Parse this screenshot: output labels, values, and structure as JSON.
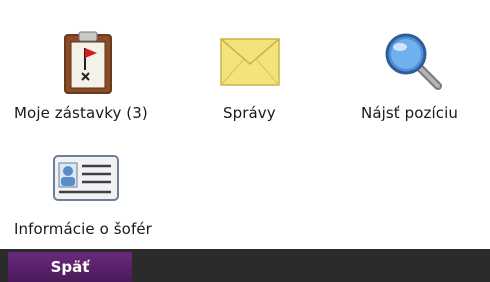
{
  "menu": {
    "items": [
      {
        "label": "Moje zástavky (3)",
        "icon": "clipboard-flag-icon"
      },
      {
        "label": "Správy",
        "icon": "envelope-icon"
      },
      {
        "label": "Nájsť pozíciu",
        "icon": "magnifier-icon"
      },
      {
        "label": "Informácie o šofér",
        "icon": "id-card-icon"
      }
    ]
  },
  "bottom_bar": {
    "back_label": "Späť"
  },
  "colors": {
    "background": "#ffffff",
    "bottom_bar": "#2b2b2b",
    "back_button": "#5a2168",
    "envelope": "#f4e27a"
  }
}
